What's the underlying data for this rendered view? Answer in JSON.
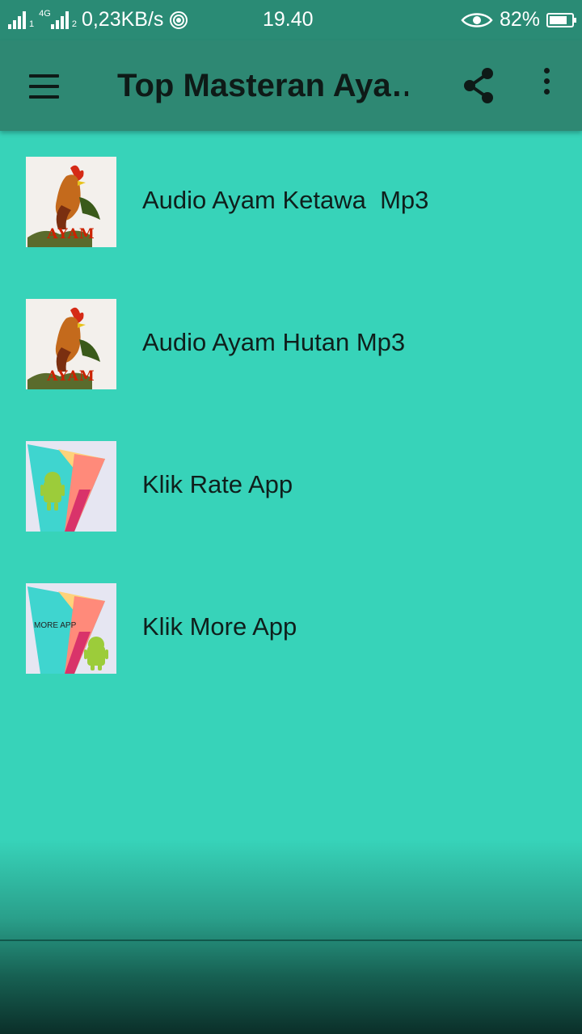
{
  "status_bar": {
    "net_speed": "0,23KB/s",
    "sim1": "1",
    "sim2": "2",
    "network_type": "4G",
    "time": "19.40",
    "battery": "82%",
    "battery_level": 0.82
  },
  "app_bar": {
    "title": "Top Masteran Aya…",
    "menu_icon": "hamburger-menu-icon",
    "share_icon": "share-icon",
    "more_icon": "more-vert-icon"
  },
  "list": {
    "items": [
      {
        "label": "Audio Ayam Ketawa  Mp3",
        "thumb": "rooster",
        "thumb_text": "AYAM"
      },
      {
        "label": "Audio Ayam Hutan Mp3",
        "thumb": "rooster",
        "thumb_text": "AYAM"
      },
      {
        "label": "Klik Rate App",
        "thumb": "play-store-android"
      },
      {
        "label": "Klik More App",
        "thumb": "play-store-android",
        "thumb_text": "MORE APP"
      }
    ]
  },
  "colors": {
    "background": "#37d3b9",
    "app_bar": "#2e8873",
    "status_bar": "#2a8b75"
  }
}
